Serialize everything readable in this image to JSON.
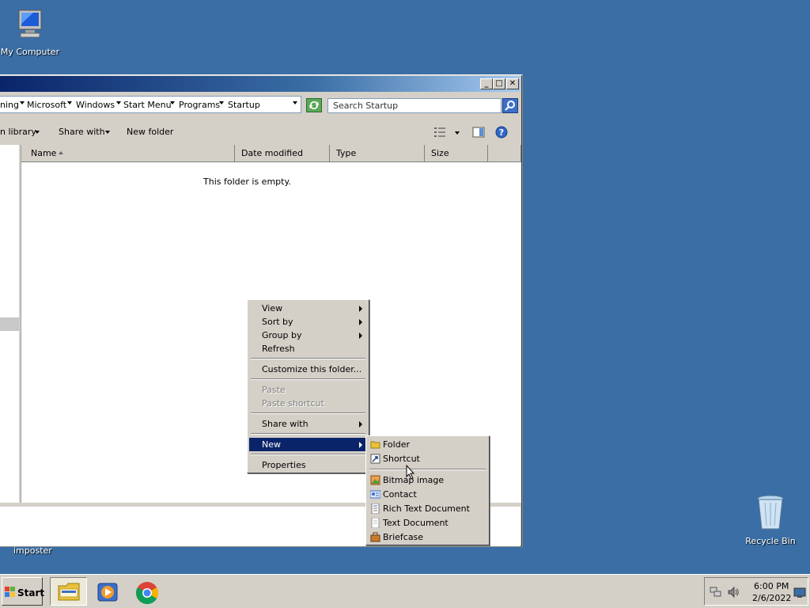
{
  "desktop": {
    "my_computer": "My Computer",
    "recycle_bin": "Recycle Bin",
    "imposter": "imposter"
  },
  "window": {
    "breadcrumbs": [
      "ning",
      "Microsoft",
      "Windows",
      "Start Menu",
      "Programs",
      "Startup"
    ],
    "search_placeholder": "Search Startup",
    "toolbar": {
      "include_library": "n library",
      "share_with": "Share with",
      "new_folder": "New folder"
    },
    "columns": [
      "Name",
      "Date modified",
      "Type",
      "Size"
    ],
    "empty_message": "This folder is empty.",
    "controls": {
      "minimize": "_",
      "maximize": "□",
      "close": "✕"
    }
  },
  "context_menu": {
    "items": [
      {
        "label": "View",
        "submenu": true
      },
      {
        "label": "Sort by",
        "submenu": true
      },
      {
        "label": "Group by",
        "submenu": true
      },
      {
        "label": "Refresh"
      },
      {
        "label": "Customize this folder..."
      },
      {
        "label": "Paste",
        "disabled": true
      },
      {
        "label": "Paste shortcut",
        "disabled": true
      },
      {
        "label": "Share with",
        "submenu": true
      },
      {
        "label": "New",
        "submenu": true,
        "selected": true
      },
      {
        "label": "Properties"
      }
    ]
  },
  "new_submenu": {
    "items": [
      {
        "label": "Folder",
        "icon": "folder-icon"
      },
      {
        "label": "Shortcut",
        "icon": "shortcut-icon"
      },
      {
        "label": "Bitmap image",
        "icon": "bitmap-icon"
      },
      {
        "label": "Contact",
        "icon": "contact-icon"
      },
      {
        "label": "Rich Text Document",
        "icon": "rich-text-icon"
      },
      {
        "label": "Text Document",
        "icon": "text-document-icon"
      },
      {
        "label": "Briefcase",
        "icon": "briefcase-icon"
      }
    ]
  },
  "taskbar": {
    "start_label": "Start",
    "clock_time": "6:00 PM",
    "clock_date": "2/6/2022"
  },
  "colors": {
    "desktop": "#3a6ea5",
    "selection": "#0a246a",
    "chrome": "#d4d0c8"
  }
}
